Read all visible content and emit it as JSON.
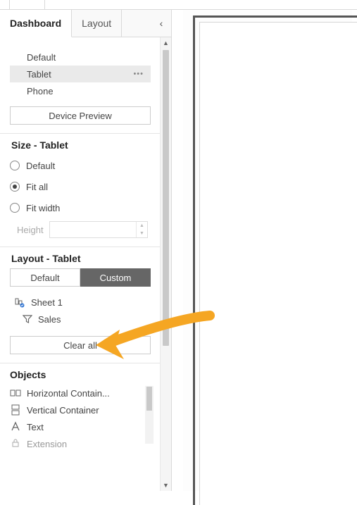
{
  "tabs": {
    "dashboard": "Dashboard",
    "layout": "Layout",
    "collapse_glyph": "‹"
  },
  "devices": {
    "default": "Default",
    "tablet": "Tablet",
    "phone": "Phone",
    "preview_btn": "Device Preview"
  },
  "size": {
    "title": "Size - Tablet",
    "opt_default": "Default",
    "opt_fit_all": "Fit all",
    "opt_fit_width": "Fit width",
    "height_label": "Height"
  },
  "layout": {
    "title": "Layout - Tablet",
    "btn_default": "Default",
    "btn_custom": "Custom",
    "item_sheet1": "Sheet 1",
    "item_sales": "Sales",
    "clear_all": "Clear all"
  },
  "objects": {
    "title": "Objects",
    "horizontal": "Horizontal Contain...",
    "vertical": "Vertical Container",
    "text": "Text",
    "extension": "Extension"
  }
}
